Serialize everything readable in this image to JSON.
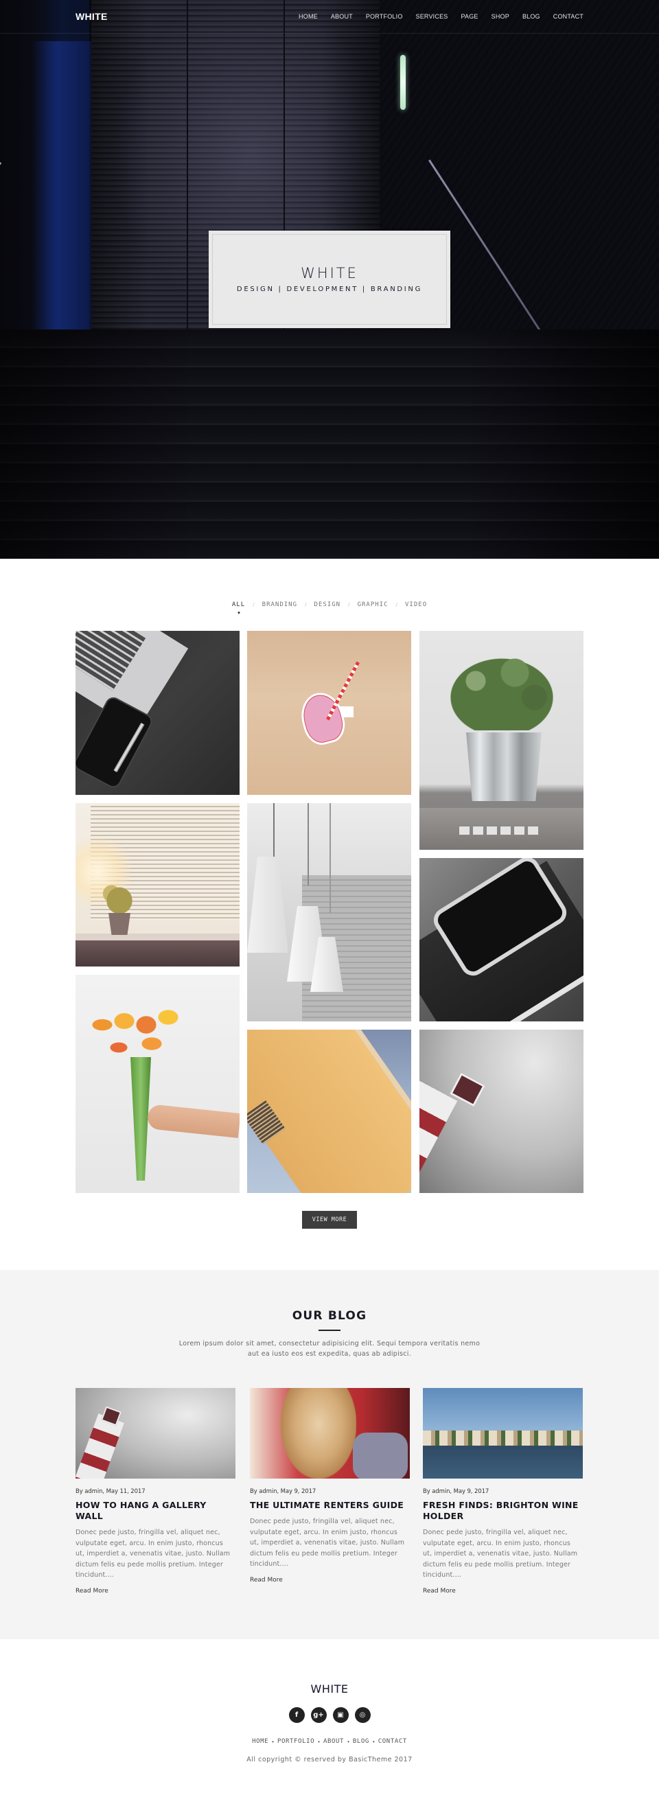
{
  "header": {
    "logo": "WHITE",
    "nav": [
      "HOME",
      "ABOUT",
      "PORTFOLIO",
      "SERVICES",
      "PAGE",
      "SHOP",
      "BLOG",
      "CONTACT"
    ]
  },
  "hero": {
    "title": "WHITE",
    "subtitle": "DESIGN | DEVELOPMENT | BRANDING"
  },
  "portfolio": {
    "filters": [
      {
        "label": "ALL",
        "active": true
      },
      {
        "label": "BRANDING",
        "active": false
      },
      {
        "label": "DESIGN",
        "active": false
      },
      {
        "label": "GRAPHIC",
        "active": false
      },
      {
        "label": "VIDEO",
        "active": false
      }
    ],
    "items": [
      {
        "subject": "laptop, phone and pen on dark desk"
      },
      {
        "subject": "heart-shaped cup with striped straw"
      },
      {
        "subject": "potted plant in metal bucket"
      },
      {
        "subject": "small plant on window sill with blinds"
      },
      {
        "subject": "white pendant lamps"
      },
      {
        "subject": "smartphone on notebook"
      },
      {
        "subject": "hand holding tulip bouquet"
      },
      {
        "subject": "building corner against blue sky"
      },
      {
        "subject": "red and white lighthouse"
      }
    ],
    "view_more": "VIEW MORE"
  },
  "blog": {
    "title": "OUR BLOG",
    "intro": "Lorem ipsum dolor sit amet, consectetur adipisicing elit. Sequi tempora veritatis nemo aut ea iusto eos est expedita, quas ab adipisci.",
    "posts": [
      {
        "meta": "By admin, May 11, 2017",
        "title": "HOW TO HANG A GALLERY WALL",
        "excerpt": "Donec pede justo, fringilla vel, aliquet nec, vulputate eget, arcu. In enim justo, rhoncus ut, imperdiet a, venenatis vitae, justo. Nullam dictum felis eu pede mollis pretium. Integer tincidunt....",
        "read_more": "Read More"
      },
      {
        "meta": "By admin, May 9, 2017",
        "title": "THE ULTIMATE RENTERS GUIDE",
        "excerpt": "Donec pede justo, fringilla vel, aliquet nec, vulputate eget, arcu. In enim justo, rhoncus ut, imperdiet a, venenatis vitae, justo. Nullam dictum felis eu pede mollis pretium. Integer tincidunt....",
        "read_more": "Read More"
      },
      {
        "meta": "By admin, May 9, 2017",
        "title": "FRESH FINDS: BRIGHTON WINE HOLDER",
        "excerpt": "Donec pede justo, fringilla vel, aliquet nec, vulputate eget, arcu. In enim justo, rhoncus ut, imperdiet a, venenatis vitae, justo. Nullam dictum felis eu pede mollis pretium. Integer tincidunt....",
        "read_more": "Read More"
      }
    ]
  },
  "footer": {
    "logo": "WHITE",
    "social": [
      {
        "icon": "facebook-icon",
        "glyph": "f"
      },
      {
        "icon": "google-plus-icon",
        "glyph": "g+"
      },
      {
        "icon": "instagram-icon",
        "glyph": "▣"
      },
      {
        "icon": "dribbble-icon",
        "glyph": "◎"
      }
    ],
    "links": [
      "HOME",
      "PORTFOLIO",
      "ABOUT",
      "BLOG",
      "CONTACT"
    ],
    "separator": "•",
    "copyright": "All copyright © reserved by BasicTheme 2017"
  },
  "colors": {
    "button_bg": "#3d3d3d",
    "blog_bg": "#f4f4f4",
    "hero_box_bg": "#e9e9e9",
    "text_dark": "#15161f"
  }
}
